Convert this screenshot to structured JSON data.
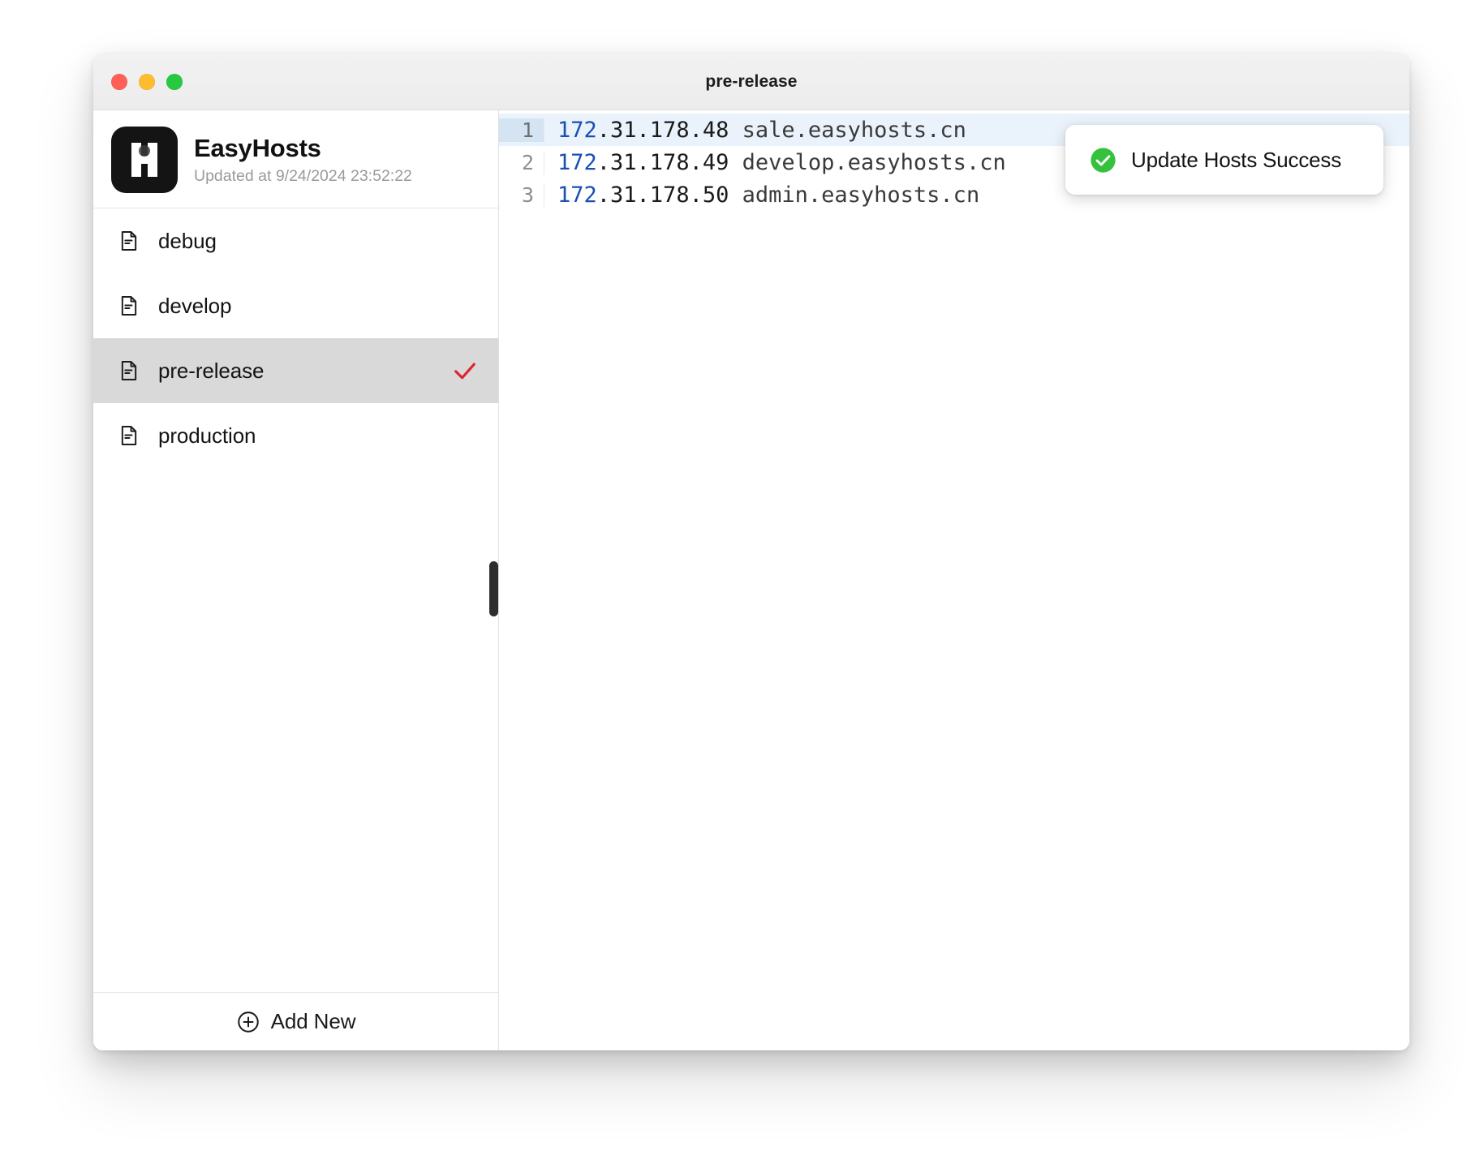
{
  "window": {
    "title": "pre-release",
    "traffic_lights": [
      {
        "name": "close",
        "color": "#ff5f57"
      },
      {
        "name": "minimize",
        "color": "#febc2e"
      },
      {
        "name": "maximize",
        "color": "#28c840"
      }
    ]
  },
  "sidebar": {
    "app_name": "EasyHosts",
    "updated_label": "Updated at 9/24/2024 23:52:22",
    "logo_icon": "easyhosts-h-logo",
    "items": [
      {
        "label": "debug",
        "icon": "document-icon",
        "selected": false,
        "checked": false
      },
      {
        "label": "develop",
        "icon": "document-icon",
        "selected": false,
        "checked": false
      },
      {
        "label": "pre-release",
        "icon": "document-icon",
        "selected": true,
        "checked": true
      },
      {
        "label": "production",
        "icon": "document-icon",
        "selected": false,
        "checked": false
      }
    ],
    "check_color": "#e0232e",
    "selected_bg": "#d9d9d9",
    "footer": {
      "add_new_label": "Add New",
      "add_new_icon": "plus-circle-icon"
    }
  },
  "editor": {
    "active_line": 1,
    "active_line_bg": "#eaf3fb",
    "ip_prefix_color": "#1a4fb4",
    "lines": [
      {
        "number": "1",
        "ip_prefix": "172",
        "ip_rest": ".31.178.48",
        "host": " sale.easyhosts.cn"
      },
      {
        "number": "2",
        "ip_prefix": "172",
        "ip_rest": ".31.178.49",
        "host": " develop.easyhosts.cn"
      },
      {
        "number": "3",
        "ip_prefix": "172",
        "ip_rest": ".31.178.50",
        "host": " admin.easyhosts.cn"
      }
    ]
  },
  "toast": {
    "message": "Update Hosts Success",
    "icon": "success-check-circle-icon",
    "icon_color": "#34c23c"
  }
}
